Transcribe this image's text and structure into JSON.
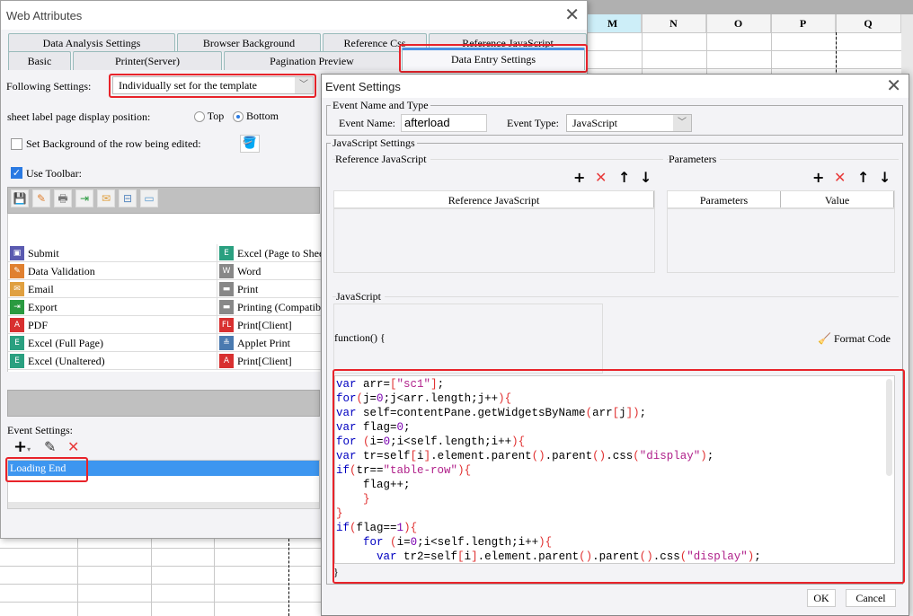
{
  "spreadsheet": {
    "columns": [
      "M",
      "N",
      "O",
      "P",
      "Q"
    ],
    "active_column": "M"
  },
  "web_attributes": {
    "title": "Web Attributes",
    "tabs_row1": [
      "Data Analysis Settings",
      "Browser Background",
      "Reference Css",
      "Reference JavaScript"
    ],
    "tabs_row2": [
      "Basic",
      "Printer(Server)",
      "Pagination Preview",
      "Data Entry Settings"
    ],
    "active_tab": "Data Entry Settings",
    "following_settings_label": "Following Settings:",
    "following_settings_value": "Individually set for the template",
    "sheet_label_position_label": "sheet label page display position:",
    "position_options": [
      "Top",
      "Bottom"
    ],
    "position_selected": "Bottom",
    "set_background_label": "Set Background of the row being edited:",
    "set_background_checked": false,
    "use_toolbar_label": "Use Toolbar:",
    "use_toolbar_checked": true,
    "toolbar_icons": [
      "save-icon",
      "data-validation-icon",
      "print-icon",
      "export-icon",
      "email-icon",
      "tree-icon",
      "window-icon"
    ],
    "buttons_left": [
      {
        "label": "Submit",
        "icon": "save-icon"
      },
      {
        "label": "Data Validation",
        "icon": "data-validation-icon"
      },
      {
        "label": "Email",
        "icon": "email-icon"
      },
      {
        "label": "Export",
        "icon": "export-icon"
      },
      {
        "label": "PDF",
        "icon": "pdf-icon"
      },
      {
        "label": "Excel (Full Page)",
        "icon": "excel-icon"
      },
      {
        "label": "Excel (Unaltered)",
        "icon": "excel-icon"
      }
    ],
    "buttons_right": [
      {
        "label": "Excel (Page to Sheet)",
        "icon": "excel-icon"
      },
      {
        "label": "Word",
        "icon": "word-icon"
      },
      {
        "label": "Print",
        "icon": "print-icon"
      },
      {
        "label": "Printing (Compatible)",
        "icon": "print-icon"
      },
      {
        "label": "Print[Client]",
        "icon": "flash-print-icon"
      },
      {
        "label": "Applet Print",
        "icon": "applet-print-icon"
      },
      {
        "label": "Print[Client]",
        "icon": "pdf-print-icon"
      }
    ],
    "event_settings_label": "Event Settings:",
    "events": [
      "Loading End"
    ],
    "selected_event": "Loading End"
  },
  "event_settings": {
    "title": "Event Settings",
    "group_name_type": "Event Name and Type",
    "event_name_label": "Event Name:",
    "event_name_value": "afterload",
    "event_type_label": "Event Type:",
    "event_type_value": "JavaScript",
    "group_js_settings": "JavaScript Settings",
    "ref_js_title": "Reference JavaScript",
    "ref_js_column": "Reference JavaScript",
    "params_title": "Parameters",
    "params_columns": [
      "Parameters",
      "Value"
    ],
    "javascript_title": "JavaScript",
    "function_header": "function() {",
    "format_code_label": "Format Code",
    "code_lines": [
      "var arr=[\"sc1\"];",
      "for(j=0;j<arr.length;j++){",
      "var self=contentPane.getWidgetsByName(arr[j]);",
      "var flag=0;",
      "for (i=0;i<self.length;i++){",
      "var tr=self[i].element.parent().parent().css(\"display\");",
      "if(tr==\"table-row\"){",
      "    flag++;",
      "    }",
      "}",
      "if(flag==1){",
      "    for (i=0;i<self.length;i++){",
      "      var tr2=self[i].element.parent().parent().css(\"display\");"
    ],
    "function_footer": "}",
    "ok_label": "OK",
    "cancel_label": "Cancel"
  },
  "colors": {
    "highlight_red": "#e8232a",
    "selection_blue": "#3d96f0",
    "keyword": "#0000c0",
    "string": "#b0208a",
    "number": "#7a00b0",
    "bracket": "#e03030"
  }
}
